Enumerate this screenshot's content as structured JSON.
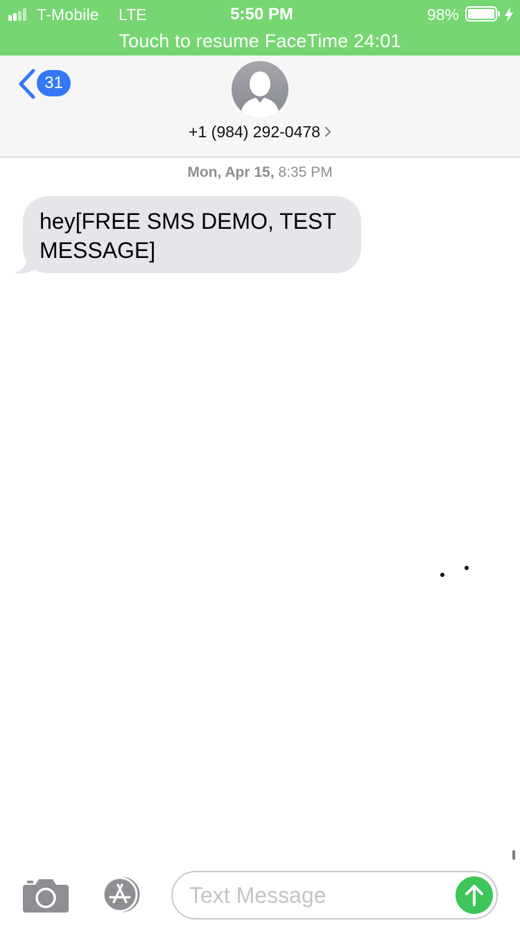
{
  "status_bar": {
    "carrier": "T-Mobile",
    "network": "LTE",
    "time": "5:50 PM",
    "battery_percent": "98%",
    "signal_icon": "signal-bars-icon",
    "battery_icon": "battery-icon",
    "charging_icon": "charging-bolt-icon"
  },
  "facetime_banner": {
    "text": "Touch to resume FaceTime 24:01"
  },
  "header": {
    "back_icon": "chevron-left-icon",
    "unread_count": "31",
    "avatar_icon": "person-silhouette-icon",
    "contact_name": "+1 (984) 292-0478",
    "detail_icon": "chevron-right-icon"
  },
  "conversation": {
    "timestamp_date": "Mon, Apr 15,",
    "timestamp_time": "8:35 PM",
    "messages": [
      {
        "direction": "incoming",
        "text": "hey[FREE SMS DEMO, TEST MESSAGE]"
      }
    ]
  },
  "input_bar": {
    "camera_icon": "camera-icon",
    "apps_icon": "app-store-icon",
    "placeholder": "Text Message",
    "value": "",
    "send_icon": "arrow-up-icon"
  },
  "colors": {
    "status_bar_green": "#76d672",
    "ios_blue": "#3478f6",
    "incoming_bubble": "#e5e5ea",
    "send_green": "#3dc55a",
    "secondary_gray": "#8e8e93"
  }
}
